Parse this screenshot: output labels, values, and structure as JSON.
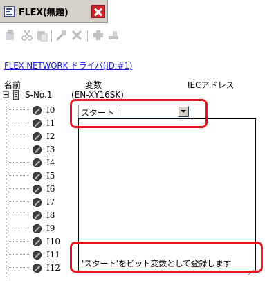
{
  "tab": {
    "title": "FLEX(無題)",
    "icon": "screen-icon",
    "close_icon": "close-icon",
    "close_color": "#d3262e"
  },
  "toolbar": {
    "buttons": [
      "insert-icon",
      "cut-icon",
      "paste-icon",
      "add-icon",
      "delete-icon",
      "add-device-icon",
      "remove-device-icon"
    ]
  },
  "driver_link": "FLEX NETWORK ドライバ(ID:#1)",
  "columns": {
    "name": "名前",
    "variable": "変数",
    "iec_address": "IECアドレス"
  },
  "tree": {
    "root_label": "S-No.1",
    "root_model": "(EN-XY16SK)",
    "leaves": [
      "I0",
      "I1",
      "I2",
      "I3",
      "I4",
      "I5",
      "I6",
      "I7",
      "I8",
      "I9",
      "I10",
      "I11",
      "I12"
    ]
  },
  "variable_input": {
    "value": "スタート"
  },
  "dropdown": {
    "hint": "'スタート'をビット変数として登録します"
  },
  "colors": {
    "callout": "#e8141e",
    "link": "#1a1ad6"
  }
}
